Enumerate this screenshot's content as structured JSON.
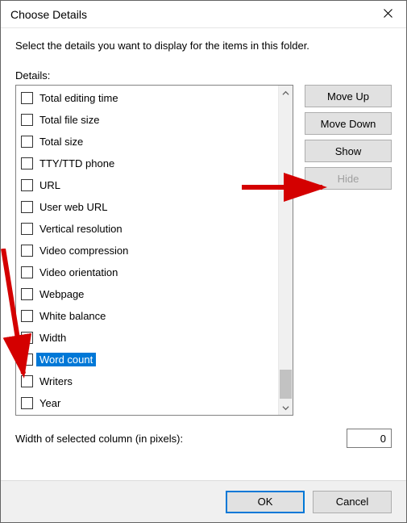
{
  "window": {
    "title": "Choose Details"
  },
  "instructions": "Select the details you want to display for the items in this folder.",
  "details_label": "Details:",
  "items": [
    {
      "label": "Total editing time",
      "checked": false,
      "selected": false
    },
    {
      "label": "Total file size",
      "checked": false,
      "selected": false
    },
    {
      "label": "Total size",
      "checked": false,
      "selected": false
    },
    {
      "label": "TTY/TTD phone",
      "checked": false,
      "selected": false
    },
    {
      "label": "URL",
      "checked": false,
      "selected": false
    },
    {
      "label": "User web URL",
      "checked": false,
      "selected": false
    },
    {
      "label": "Vertical resolution",
      "checked": false,
      "selected": false
    },
    {
      "label": "Video compression",
      "checked": false,
      "selected": false
    },
    {
      "label": "Video orientation",
      "checked": false,
      "selected": false
    },
    {
      "label": "Webpage",
      "checked": false,
      "selected": false
    },
    {
      "label": "White balance",
      "checked": false,
      "selected": false
    },
    {
      "label": "Width",
      "checked": false,
      "selected": false
    },
    {
      "label": "Word count",
      "checked": false,
      "selected": true
    },
    {
      "label": "Writers",
      "checked": false,
      "selected": false
    },
    {
      "label": "Year",
      "checked": false,
      "selected": false
    }
  ],
  "side": {
    "move_up": "Move Up",
    "move_down": "Move Down",
    "show": "Show",
    "hide": "Hide"
  },
  "width_label": "Width of selected column (in pixels):",
  "width_value": "0",
  "footer": {
    "ok": "OK",
    "cancel": "Cancel"
  }
}
